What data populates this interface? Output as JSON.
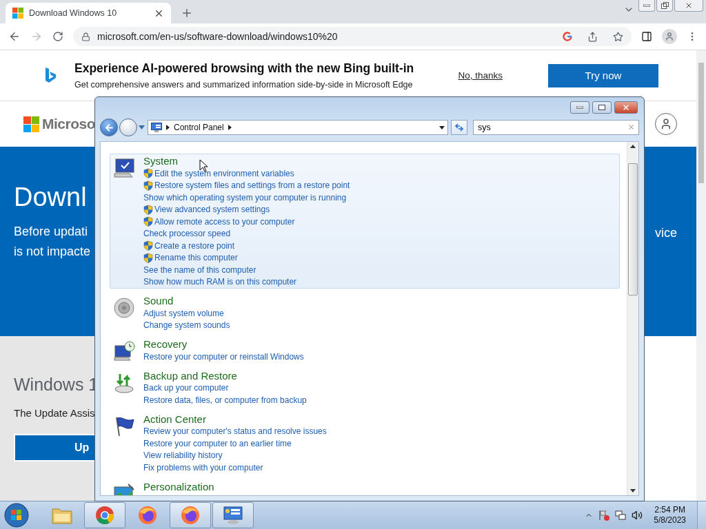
{
  "browser": {
    "tab": {
      "title": "Download Windows 10"
    },
    "url": "microsoft.com/en-us/software-download/windows10%20",
    "banner": {
      "title": "Experience AI-powered browsing with the new Bing built-in",
      "subtitle": "Get comprehensive answers and summarized information side-by-side in Microsoft Edge",
      "dismiss": "No, thanks",
      "action": "Try now"
    },
    "page": {
      "logo_text": "Microso",
      "hero_title": "Downl",
      "hero_lines": [
        "Before updati",
        "is not impacte"
      ],
      "hero_right": "vice",
      "section_title": "Windows 1",
      "section_text": "The Update Assis",
      "button_label": "Up"
    }
  },
  "control_panel": {
    "breadcrumb": [
      "Control Panel"
    ],
    "search": {
      "value": "sys"
    },
    "results": [
      {
        "kind": "system",
        "title": "System",
        "selected": true,
        "links": [
          {
            "text": "Edit the system environment variables",
            "shield": true
          },
          {
            "text": "Restore system files and settings from a restore point",
            "shield": true
          },
          {
            "text": "Show which operating system your computer is running",
            "shield": false
          },
          {
            "text": "View advanced system settings",
            "shield": true
          },
          {
            "text": "Allow remote access to your computer",
            "shield": true
          },
          {
            "text": "Check processor speed",
            "shield": false
          },
          {
            "text": "Create a restore point",
            "shield": true
          },
          {
            "text": "Rename this computer",
            "shield": true
          },
          {
            "text": "See the name of this computer",
            "shield": false
          },
          {
            "text": "Show how much RAM is on this computer",
            "shield": false
          }
        ]
      },
      {
        "kind": "sound",
        "title": "Sound",
        "selected": false,
        "links": [
          {
            "text": "Adjust system volume",
            "shield": false
          },
          {
            "text": "Change system sounds",
            "shield": false
          }
        ]
      },
      {
        "kind": "recovery",
        "title": "Recovery",
        "selected": false,
        "links": [
          {
            "text": "Restore your computer or reinstall Windows",
            "shield": false
          }
        ]
      },
      {
        "kind": "backup",
        "title": "Backup and Restore",
        "selected": false,
        "links": [
          {
            "text": "Back up your computer",
            "shield": false
          },
          {
            "text": "Restore data, files, or computer from backup",
            "shield": false
          }
        ]
      },
      {
        "kind": "action",
        "title": "Action Center",
        "selected": false,
        "links": [
          {
            "text": "Review your computer's status and resolve issues",
            "shield": false
          },
          {
            "text": "Restore your computer to an earlier time",
            "shield": false
          },
          {
            "text": "View reliability history",
            "shield": false
          },
          {
            "text": "Fix problems with your computer",
            "shield": false
          }
        ]
      },
      {
        "kind": "personalization",
        "title": "Personalization",
        "selected": false
      }
    ]
  },
  "taskbar": {
    "items": [
      {
        "kind": "explorer",
        "running": false
      },
      {
        "kind": "chrome",
        "running": true
      },
      {
        "kind": "firefox",
        "running": false
      },
      {
        "kind": "firefox",
        "running": true
      },
      {
        "kind": "controlpanel",
        "running": true
      }
    ],
    "clock": {
      "time": "2:54 PM",
      "date": "5/8/2023"
    }
  }
}
